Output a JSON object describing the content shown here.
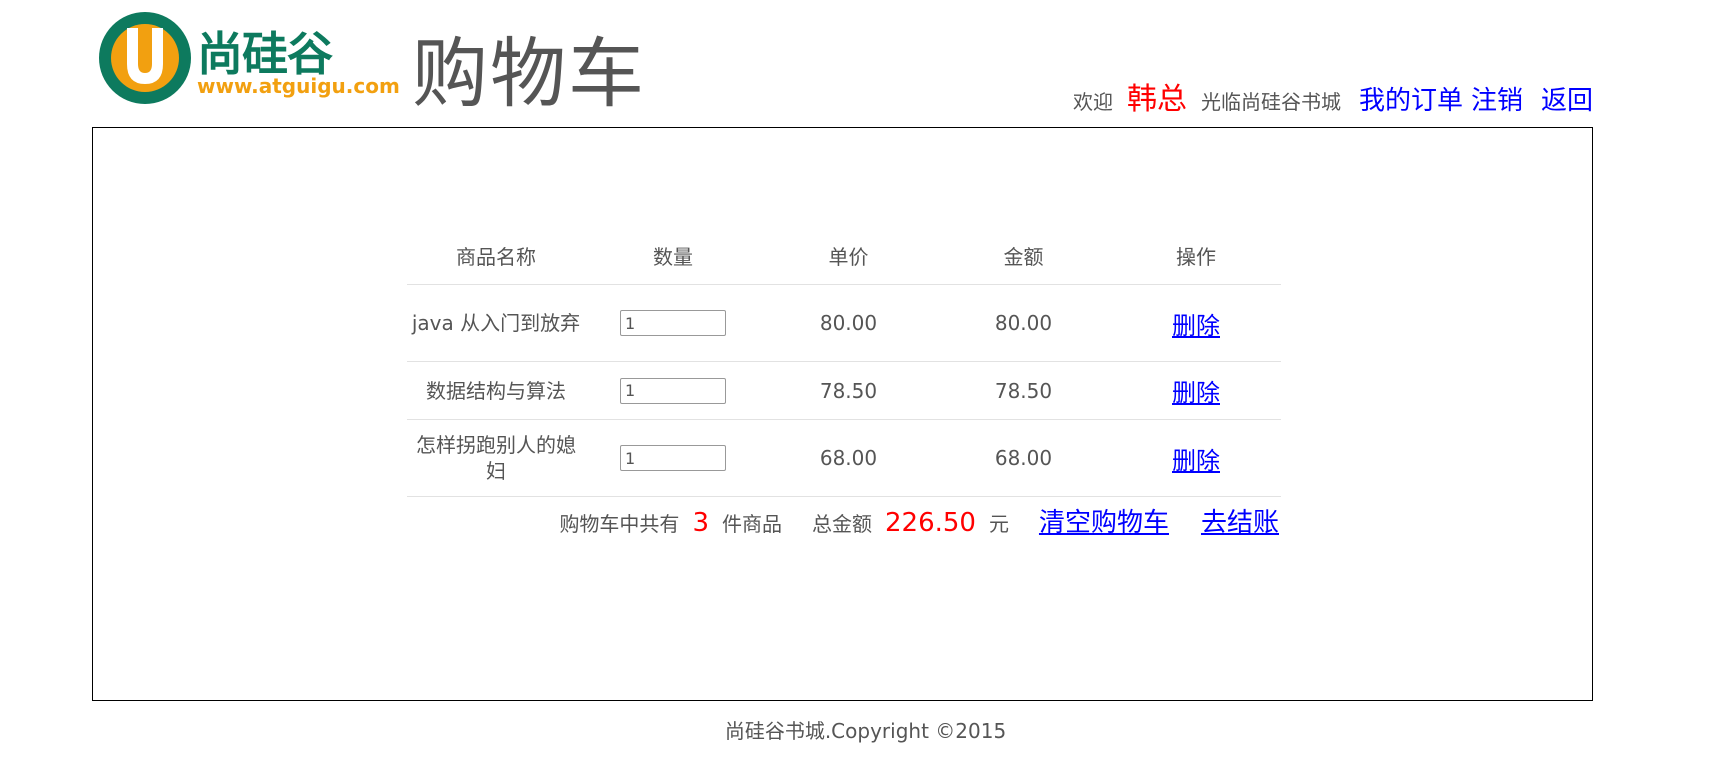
{
  "header": {
    "logo_brand": "尚硅谷",
    "logo_url": "www.atguigu.com",
    "page_title": "购物车",
    "welcome_prefix": "欢迎",
    "username": "韩总",
    "welcome_suffix": "光临尚硅谷书城",
    "my_orders": "我的订单",
    "logout": "注销",
    "back": "返回"
  },
  "table": {
    "headers": [
      "商品名称",
      "数量",
      "单价",
      "金额",
      "操作"
    ],
    "rows": [
      {
        "name": "java 从入门到放弃",
        "quantity": "1",
        "price": "80.00",
        "amount": "80.00",
        "action": "删除"
      },
      {
        "name": "数据结构与算法",
        "quantity": "1",
        "price": "78.50",
        "amount": "78.50",
        "action": "删除"
      },
      {
        "name": "怎样拐跑别人的媳妇",
        "quantity": "1",
        "price": "68.00",
        "amount": "68.00",
        "action": "删除"
      }
    ]
  },
  "summary": {
    "count_prefix": "购物车中共有",
    "count": "3",
    "count_suffix": "件商品",
    "total_prefix": "总金额",
    "total": "226.50",
    "total_suffix": "元",
    "clear_cart": "清空购物车",
    "checkout": "去结账"
  },
  "footer": {
    "copyright": "尚硅谷书城.Copyright ©2015"
  },
  "colors": {
    "link": "#0000ff",
    "highlight": "#ff0000",
    "text": "#555555",
    "logo_green": "#0d7a5e",
    "logo_orange": "#f2a010"
  }
}
